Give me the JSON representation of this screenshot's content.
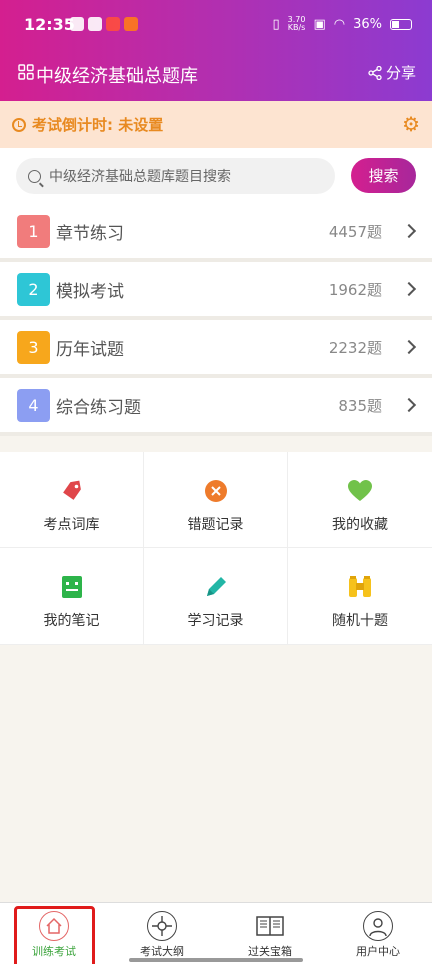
{
  "status_bar": {
    "time": "12:35",
    "speed": "3.70\nKB/s",
    "battery": "36%"
  },
  "header": {
    "title": "中级经济基础总题库",
    "share_label": "分享"
  },
  "countdown": {
    "text": "考试倒计时: 未设置"
  },
  "search": {
    "placeholder": "中级经济基础总题库题目搜索",
    "button_label": "搜索"
  },
  "categories": [
    {
      "index": "1",
      "label": "章节练习",
      "count": "4457题",
      "color": "#f17c7c"
    },
    {
      "index": "2",
      "label": "模拟考试",
      "count": "1962题",
      "color": "#2ec6d6"
    },
    {
      "index": "3",
      "label": "历年试题",
      "count": "2232题",
      "color": "#f7a71c"
    },
    {
      "index": "4",
      "label": "综合练习题",
      "count": "835题",
      "color": "#8c9ef2"
    }
  ],
  "tools": [
    {
      "label": "考点词库",
      "icon": "tag-icon",
      "color": "#e0464a"
    },
    {
      "label": "错题记录",
      "icon": "close-circle-icon",
      "color": "#ee7b2b"
    },
    {
      "label": "我的收藏",
      "icon": "heart-icon",
      "color": "#71c24a"
    },
    {
      "label": "我的笔记",
      "icon": "notebook-icon",
      "color": "#2db44a"
    },
    {
      "label": "学习记录",
      "icon": "pencil-icon",
      "color": "#22b6a6"
    },
    {
      "label": "随机十题",
      "icon": "binoculars-icon",
      "color": "#f6c21c"
    }
  ],
  "tabbar": [
    {
      "label": "训练考试",
      "icon": "home-icon",
      "active": true
    },
    {
      "label": "考试大纲",
      "icon": "target-icon",
      "active": false
    },
    {
      "label": "过关宝箱",
      "icon": "book-icon",
      "active": false
    },
    {
      "label": "用户中心",
      "icon": "user-icon",
      "active": false
    }
  ],
  "colors": {
    "accent": "#d41f8f",
    "countdown_text": "#e88a21",
    "active_tab": "#39a33a"
  }
}
